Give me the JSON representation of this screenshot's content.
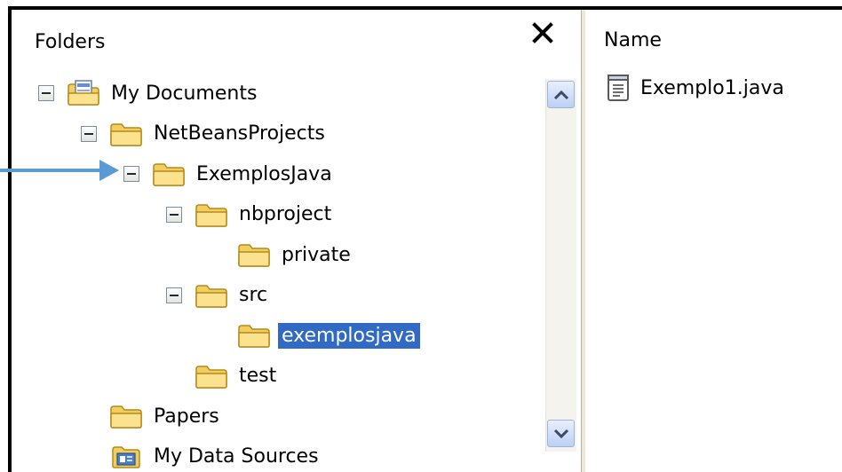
{
  "folders_pane": {
    "title": "Folders",
    "close_label": "×"
  },
  "name_pane": {
    "title": "Name",
    "files": [
      {
        "label": "Exemplo1.java",
        "icon": "text-file-icon"
      }
    ]
  },
  "tree": [
    {
      "label": "My Documents",
      "icon": "my-documents-icon",
      "level": 0,
      "expanded": true,
      "selected": false
    },
    {
      "label": "NetBeansProjects",
      "icon": "folder-icon",
      "level": 1,
      "expanded": true,
      "selected": false
    },
    {
      "label": "ExemplosJava",
      "icon": "folder-icon",
      "level": 2,
      "expanded": true,
      "selected": false
    },
    {
      "label": "nbproject",
      "icon": "folder-icon",
      "level": 3,
      "expanded": true,
      "selected": false
    },
    {
      "label": "private",
      "icon": "folder-icon",
      "level": 4,
      "expanded": false,
      "selected": false
    },
    {
      "label": "src",
      "icon": "folder-icon",
      "level": 3,
      "expanded": true,
      "selected": false
    },
    {
      "label": "exemplosjava",
      "icon": "folder-icon",
      "level": 4,
      "expanded": false,
      "selected": true
    },
    {
      "label": "test",
      "icon": "folder-icon",
      "level": 3,
      "expanded": false,
      "selected": false
    },
    {
      "label": "Papers",
      "icon": "folder-icon",
      "level": 1,
      "expanded": false,
      "selected": false
    },
    {
      "label": "My Data Sources",
      "icon": "data-sources-icon",
      "level": 1,
      "expanded": false,
      "selected": false
    }
  ],
  "colors": {
    "selection": "#316ac5",
    "folder": "#f5d468",
    "arrow": "#5b9bd5"
  }
}
